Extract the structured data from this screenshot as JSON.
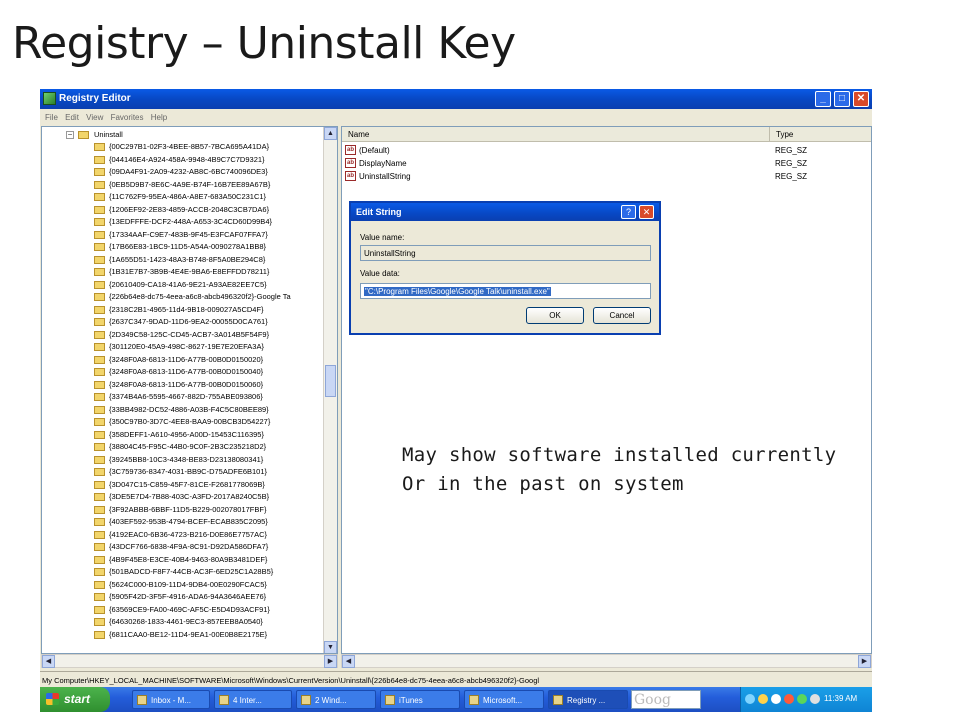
{
  "slide": {
    "title": "Registry – Uninstall Key",
    "notes": [
      "May show software installed currently",
      "Or in the past on system"
    ]
  },
  "window": {
    "title": "Registry Editor",
    "menu": [
      "File",
      "Edit",
      "View",
      "Favorites",
      "Help"
    ],
    "buttons": {
      "minimize": "_",
      "maximize": "□",
      "close": "✕"
    }
  },
  "tree": {
    "root_label": "Uninstall",
    "keys": [
      "{00C297B1-02F3-4BEE-8B57-7BCA695A41DA}",
      "{044146E4-A924-458A-9948-4B9C7C7D9321}",
      "{09DA4F91-2A09-4232-AB8C-6BC740096DE3}",
      "{0EB5D9B7-8E6C-4A9E-B74F-16B7EE89A67B}",
      "{11C762F9-95EA-486A-A8E7-683A50C231C1}",
      "{1206EF92-2E83-4859-ACCB-2048C3CB7DA6}",
      "{13EDFFFE-DCF2-448A-A653-3C4CD60D99B4}",
      "{17334AAF-C9E7-483B-9F45-E3FCAF07FFA7}",
      "{17B66E83-1BC9-11D5-A54A-0090278A1BB8}",
      "{1A655D51-1423-48A3-B748-8F5A0BE294C8}",
      "{1B31E7B7-3B9B-4E4E-9BA6-E8EFFDD78211}",
      "{20610409-CA18-41A6-9E21-A93AE82EE7C5}",
      "{226b64e8-dc75-4eea-a6c8-abcb496320f2}-Google Ta",
      "{2318C2B1-4965-11d4-9B18-009027A5CD4F}",
      "{2637C347-9DAD-11D6-9EA2-00055D0CA761}",
      "{2D349C58-125C-CD45-ACB7-3A014B5F54F9}",
      "{301120E0-45A9-498C-8627-19E7E20EFA3A}",
      "{3248F0A8-6813-11D6-A77B-00B0D0150020}",
      "{3248F0A8-6813-11D6-A77B-00B0D0150040}",
      "{3248F0A8-6813-11D6-A77B-00B0D0150060}",
      "{3374B4A6-5595-4667-882D-755ABE093806}",
      "{33BB4982-DC52-4886-A03B-F4C5C80BEE89}",
      "{350C97B0-3D7C-4EE8-BAA9-00BCB3D54227}",
      "{358DEFF1-A610-4956-A00D-15453C116395}",
      "{38804C45-F95C-44B0-9C0F-2B3C235218D2}",
      "{39245BB8-10C3-4348-BE83-D23138080341}",
      "{3C759736-8347-4031-BB9C-D75ADFE6B101}",
      "{3D047C15-C859-45F7-81CE-F2681778069B}",
      "{3DE5E7D4-7B88-403C-A3FD-2017A8240C5B}",
      "{3F92ABBB-6BBF-11D5-B229-002078017FBF}",
      "{403EF592-953B-4794-BCEF-ECAB835C2095}",
      "{4192EAC0-6B36-4723-B216-D0E86E7757AC}",
      "{43DCF766-6838-4F9A-8C91-D92DA586DFA7}",
      "{4B9F45E8-E3CE-40B4-9463-80A9B3481DEF}",
      "{501BADCD-F8F7-44CB-AC3F-6ED25C1A28B5}",
      "{5624C000-B109-11D4-9DB4-00E0290FCAC5}",
      "{5905F42D-3F5F-4916-ADA6-94A3646AEE76}",
      "{63569CE9-FA00-469C-AF5C-E5D4D93ACF91}",
      "{64630268-1833-4461-9EC3-857EEB8A0540}",
      "{6811CAA0-BE12-11D4-9EA1-00E0B8E2175E}"
    ]
  },
  "values_pane": {
    "headers": {
      "name": "Name",
      "type": "Type"
    },
    "rows": [
      {
        "name": "(Default)",
        "type": "REG_SZ"
      },
      {
        "name": "DisplayName",
        "type": "REG_SZ"
      },
      {
        "name": "UninstallString",
        "type": "REG_SZ"
      }
    ]
  },
  "dialog": {
    "title": "Edit String",
    "help": "?",
    "close": "✕",
    "value_name_label": "Value name:",
    "value_name": "UninstallString",
    "value_data_label": "Value data:",
    "value_data": "\"C:\\Program Files\\Google\\Google Talk\\uninstall.exe\"",
    "ok": "OK",
    "cancel": "Cancel"
  },
  "status_bar": "My Computer\\HKEY_LOCAL_MACHINE\\SOFTWARE\\Microsoft\\Windows\\CurrentVersion\\Uninstall\\{226b64e8-dc75-4eea-a6c8-abcb496320f2}-Googl",
  "taskbar": {
    "start": "start",
    "tasks": [
      "Inbox - M...",
      "4 Inter...",
      "2 Wind...",
      "iTunes",
      "Microsoft...",
      "Registry ..."
    ],
    "search_text": "Goog",
    "clock": "11:39 AM"
  },
  "colors": {
    "titlebar": "#0848c4",
    "taskbar": "#245edb",
    "start": "#2f8f2f",
    "selection": "#316ac5"
  }
}
